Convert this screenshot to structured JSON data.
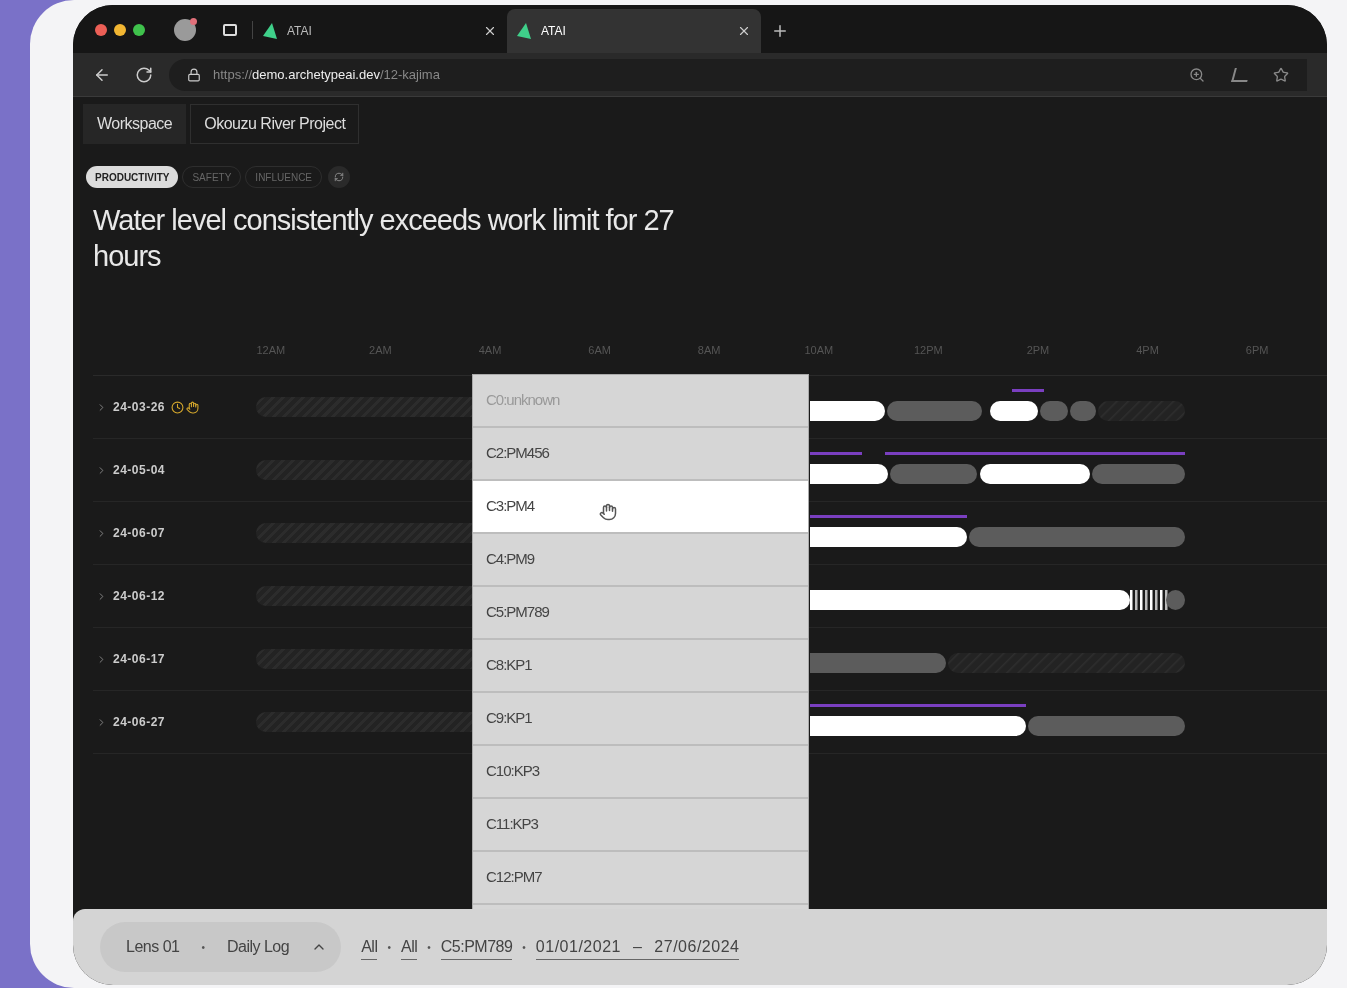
{
  "browser": {
    "tabs": [
      {
        "title": "ATAI",
        "selected": false
      },
      {
        "title": "ATAI",
        "selected": true
      }
    ],
    "url": {
      "scheme": "https://",
      "host": "demo.archetypeai.dev",
      "path": "/12-kajima"
    }
  },
  "breadcrumbs": [
    {
      "label": "Workspace",
      "selected": true
    },
    {
      "label": "Okouzu River Project",
      "selected": false
    }
  ],
  "filters": [
    {
      "label": "PRODUCTIVITY",
      "selected": true
    },
    {
      "label": "SAFETY",
      "selected": false
    },
    {
      "label": "INFLUENCE",
      "selected": false
    }
  ],
  "title": "Water level consistently exceeds work limit for 27 hours",
  "timeline": {
    "hours": [
      "12AM",
      "2AM",
      "4AM",
      "6AM",
      "8AM",
      "10AM",
      "12PM",
      "2PM",
      "4PM",
      "6PM"
    ],
    "rows": [
      {
        "date": "24-03-26",
        "alerts": true
      },
      {
        "date": "24-05-04",
        "alerts": false
      },
      {
        "date": "24-06-07",
        "alerts": false
      },
      {
        "date": "24-06-12",
        "alerts": false
      },
      {
        "date": "24-06-17",
        "alerts": false
      },
      {
        "date": "24-06-27",
        "alerts": false
      }
    ]
  },
  "dropdown": {
    "items": [
      {
        "label": "C0:unknown",
        "disabled": true,
        "selected": false
      },
      {
        "label": "C2:PM456",
        "disabled": false,
        "selected": false
      },
      {
        "label": "C3:PM4",
        "disabled": false,
        "selected": true
      },
      {
        "label": "C4:PM9",
        "disabled": false,
        "selected": false
      },
      {
        "label": "C5:PM789",
        "disabled": false,
        "selected": false
      },
      {
        "label": "C8:KP1",
        "disabled": false,
        "selected": false
      },
      {
        "label": "C9:KP1",
        "disabled": false,
        "selected": false
      },
      {
        "label": "C10:KP3",
        "disabled": false,
        "selected": false
      },
      {
        "label": "C11:KP3",
        "disabled": false,
        "selected": false
      },
      {
        "label": "C12:PM7",
        "disabled": false,
        "selected": false
      }
    ]
  },
  "bottom_bar": {
    "pill": [
      {
        "kind": "text",
        "text": "Lens 01"
      },
      {
        "kind": "dot",
        "text": "•"
      },
      {
        "kind": "text",
        "text": "Daily Log"
      }
    ],
    "items": [
      {
        "kind": "link",
        "text": "All"
      },
      {
        "kind": "dot",
        "text": "•"
      },
      {
        "kind": "link",
        "text": "All"
      },
      {
        "kind": "dot",
        "text": "•"
      },
      {
        "kind": "link",
        "text": "C5:PM789"
      },
      {
        "kind": "dot",
        "text": "•"
      },
      {
        "kind": "range",
        "from": "01/01/2021",
        "separator": "–",
        "to": "27/06/2024"
      }
    ]
  }
}
